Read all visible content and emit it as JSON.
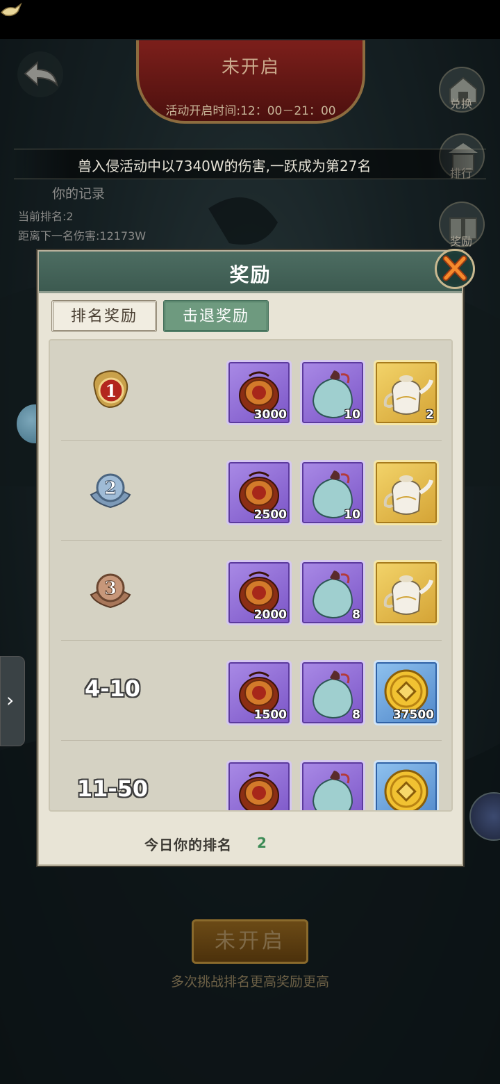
{
  "background": {
    "banner_title": "未开启",
    "banner_time": "活动开启时间:12：00－21：00",
    "marquee_text": "兽入侵活动中以7340W的伤害,一跃成为第27名",
    "side_icons": [
      {
        "label": "兑换",
        "icon": "exchange-shop-icon"
      },
      {
        "label": "排行",
        "icon": "ranking-icon"
      },
      {
        "label": "奖励",
        "icon": "reward-icon"
      }
    ],
    "record_title": "你的记录",
    "current_rank": "当前排名:2",
    "next_gap": "距离下一名伤害:12173W",
    "bottom_button": "未开启",
    "bottom_tip": "多次挑战排名更高奖励更高"
  },
  "dialog": {
    "title": "奖励",
    "tabs": [
      {
        "label": "排名奖励",
        "active": true
      },
      {
        "label": "击退奖励",
        "active": false
      }
    ],
    "rows": [
      {
        "rank": "1",
        "badge": "gold-dragon",
        "items": [
          {
            "icon": "treasure-pouch-icon",
            "qty": "3000",
            "rarity": "purple"
          },
          {
            "icon": "jade-bag-icon",
            "qty": "10",
            "rarity": "purple"
          },
          {
            "icon": "porcelain-teapot-icon",
            "qty": "2",
            "rarity": "gold"
          }
        ]
      },
      {
        "rank": "2",
        "badge": "silver",
        "items": [
          {
            "icon": "treasure-pouch-icon",
            "qty": "2500",
            "rarity": "purple"
          },
          {
            "icon": "jade-bag-icon",
            "qty": "10",
            "rarity": "purple"
          },
          {
            "icon": "porcelain-teapot-icon",
            "qty": "",
            "rarity": "gold"
          }
        ]
      },
      {
        "rank": "3",
        "badge": "bronze",
        "items": [
          {
            "icon": "treasure-pouch-icon",
            "qty": "2000",
            "rarity": "purple"
          },
          {
            "icon": "jade-bag-icon",
            "qty": "8",
            "rarity": "purple"
          },
          {
            "icon": "porcelain-teapot-icon",
            "qty": "",
            "rarity": "gold"
          }
        ]
      },
      {
        "rank": "4-10",
        "badge": "none",
        "items": [
          {
            "icon": "treasure-pouch-icon",
            "qty": "1500",
            "rarity": "purple"
          },
          {
            "icon": "jade-bag-icon",
            "qty": "8",
            "rarity": "purple"
          },
          {
            "icon": "gold-coin-icon",
            "qty": "37500",
            "rarity": "blue"
          }
        ]
      },
      {
        "rank": "11-50",
        "badge": "none",
        "items": [
          {
            "icon": "treasure-pouch-icon",
            "qty": "",
            "rarity": "purple"
          },
          {
            "icon": "jade-bag-icon",
            "qty": "",
            "rarity": "purple"
          },
          {
            "icon": "gold-coin-icon",
            "qty": "",
            "rarity": "blue"
          }
        ]
      }
    ],
    "my_rank_label": "今日你的排名",
    "my_rank_value": "2"
  }
}
